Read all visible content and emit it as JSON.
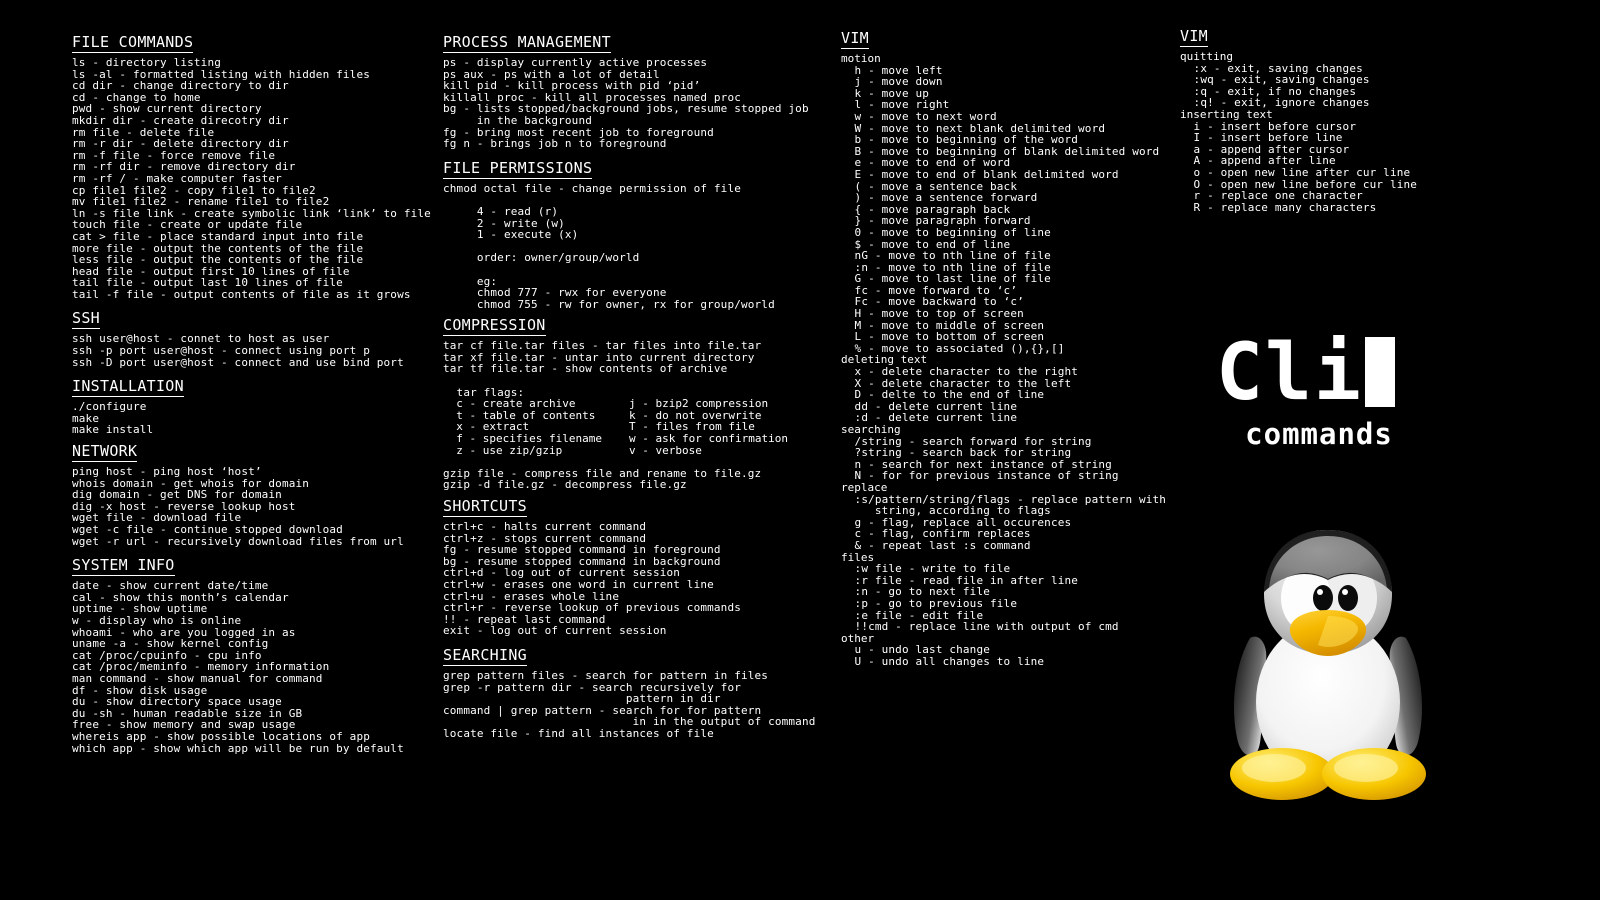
{
  "meta": {
    "background_color": "#000000",
    "text_color": "#ffffff",
    "logo_accent": "#ffffff"
  },
  "logo": {
    "title": "Cli",
    "cursor": "block-cursor",
    "subtitle": "commands"
  },
  "columns": {
    "col1": [
      {
        "heading": "FILE COMMANDS",
        "lines": [
          "ls - directory listing",
          "ls -al - formatted listing with hidden files",
          "cd dir - change directory to dir",
          "cd - change to home",
          "pwd - show current directory",
          "mkdir dir - create direcotry dir",
          "rm file - delete file",
          "rm -r dir - delete directory dir",
          "rm -f file - force remove file",
          "rm -rf dir - remove directory dir",
          "rm -rf / - make computer faster",
          "cp file1 file2 - copy file1 to file2",
          "mv file1 file2 - rename file1 to file2",
          "ln -s file link - create symbolic link ‘link’ to file",
          "touch file - create or update file",
          "cat > file - place standard input into file",
          "more file - output the contents of the file",
          "less file - output the contents of the file",
          "head file - output first 10 lines of file",
          "tail file - output last 10 lines of file",
          "tail -f file - output contents of file as it grows"
        ]
      },
      {
        "heading": "SSH",
        "lines": [
          "ssh user@host - connet to host as user",
          "ssh -p port user@host - connect using port p",
          "ssh -D port user@host - connect and use bind port"
        ]
      },
      {
        "heading": "INSTALLATION",
        "lines": [
          "./configure",
          "make",
          "make install"
        ]
      },
      {
        "heading": "NETWORK",
        "lines": [
          "ping host - ping host ‘host’",
          "whois domain - get whois for domain",
          "dig domain - get DNS for domain",
          "dig -x host - reverse lookup host",
          "wget file - download file",
          "wget -c file - continue stopped download",
          "wget -r url - recursively download files from url"
        ]
      },
      {
        "heading": "SYSTEM INFO",
        "lines": [
          "date - show current date/time",
          "cal - show this month’s calendar",
          "uptime - show uptime",
          "w - display who is online",
          "whoami - who are you logged in as",
          "uname -a - show kernel config",
          "cat /proc/cpuinfo - cpu info",
          "cat /proc/meminfo - memory information",
          "man command - show manual for command",
          "df - show disk usage",
          "du - show directory space usage",
          "du -sh - human readable size in GB",
          "free - show memory and swap usage",
          "whereis app - show possible locations of app",
          "which app - show which app will be run by default"
        ]
      }
    ],
    "col2": [
      {
        "heading": "PROCESS MANAGEMENT",
        "lines": [
          "ps - display currently active processes",
          "ps aux - ps with a lot of detail",
          "kill pid - kill process with pid ‘pid’",
          "killall proc - kill all processes named proc",
          "bg - lists stopped/background jobs, resume stopped job",
          "     in the background",
          "fg - bring most recent job to foreground",
          "fg n - brings job n to foreground"
        ]
      },
      {
        "heading": "FILE PERMISSIONS",
        "lines": [
          "chmod octal file - change permission of file",
          "",
          "     4 - read (r)",
          "     2 - write (w)",
          "     1 - execute (x)",
          "",
          "     order: owner/group/world",
          "",
          "     eg:",
          "     chmod 777 - rwx for everyone",
          "     chmod 755 - rw for owner, rx for group/world"
        ]
      },
      {
        "heading": "COMPRESSION",
        "lines": [
          "tar cf file.tar files - tar files into file.tar",
          "tar xf file.tar - untar into current directory",
          "tar tf file.tar - show contents of archive",
          "",
          "  tar flags:"
        ],
        "flag_table": {
          "rows": [
            {
              "left": "  c - create archive",
              "right": "j - bzip2 compression"
            },
            {
              "left": "  t - table of contents",
              "right": "k - do not overwrite"
            },
            {
              "left": "  x - extract",
              "right": "T - files from file"
            },
            {
              "left": "  f - specifies filename",
              "right": "w - ask for confirmation"
            },
            {
              "left": "  z - use zip/gzip",
              "right": "v - verbose"
            }
          ]
        },
        "lines_after": [
          "",
          "gzip file - compress file and rename to file.gz",
          "gzip -d file.gz - decompress file.gz"
        ]
      },
      {
        "heading": "SHORTCUTS",
        "lines": [
          "ctrl+c - halts current command",
          "ctrl+z - stops current command",
          "fg - resume stopped command in foreground",
          "bg - resume stopped command in background",
          "ctrl+d - log out of current session",
          "ctrl+w - erases one word in current line",
          "ctrl+u - erases whole line",
          "ctrl+r - reverse lookup of previous commands",
          "!! - repeat last command",
          "exit - log out of current session"
        ]
      },
      {
        "heading": "SEARCHING",
        "lines": [
          "grep pattern files - search for pattern in files",
          "grep -r pattern dir - search recursively for",
          "                           pattern in dir",
          "command | grep pattern - search for for pattern",
          "                            in in the output of command",
          "locate file - find all instances of file"
        ]
      }
    ],
    "col3": [
      {
        "heading": "VIM",
        "groups": [
          {
            "label": "motion",
            "lines": [
              "  h - move left",
              "  j - move down",
              "  k - move up",
              "  l - move right",
              "  w - move to next word",
              "  W - move to next blank delimited word",
              "  b - move to beginning of the word",
              "  B - move to beginning of blank delimited word",
              "  e - move to end of word",
              "  E - move to end of blank delimited word",
              "  ( - move a sentence back",
              "  ) - move a sentence forward",
              "  { - move paragraph back",
              "  } - move paragraph forward",
              "  0 - move to beginning of line",
              "  $ - move to end of line",
              "  nG - move to nth line of file",
              "  :n - move to nth line of file",
              "  G - move to last line of file",
              "  fc - move forward to ‘c’",
              "  Fc - move backward to ‘c’",
              "  H - move to top of screen",
              "  M - move to middle of screen",
              "  L - move to bottom of screen",
              "  % - move to associated (),{},[]"
            ]
          },
          {
            "label": "deleting text",
            "lines": [
              "  x - delete character to the right",
              "  X - delete character to the left",
              "  D - delte to the end of line",
              "  dd - delete current line",
              "  :d - delete current line"
            ]
          },
          {
            "label": "searching",
            "lines": [
              "  /string - search forward for string",
              "  ?string - search back for string",
              "  n - search for next instance of string",
              "  N - for for previous instance of string"
            ]
          },
          {
            "label": "replace",
            "lines": [
              "  :s/pattern/string/flags - replace pattern with",
              "     string, according to flags",
              "  g - flag, replace all occurences",
              "  c - flag, confirm replaces",
              "  & - repeat last :s command"
            ]
          },
          {
            "label": "files",
            "lines": [
              "  :w file - write to file",
              "  :r file - read file in after line",
              "  :n - go to next file",
              "  :p - go to previous file",
              "  :e file - edit file",
              "  !!cmd - replace line with output of cmd"
            ]
          },
          {
            "label": "other",
            "lines": [
              "  u - undo last change",
              "  U - undo all changes to line"
            ]
          }
        ]
      }
    ],
    "col4": [
      {
        "heading": "VIM",
        "groups": [
          {
            "label": "quitting",
            "lines": [
              "  :x - exit, saving changes",
              "  :wq - exit, saving changes",
              "  :q - exit, if no changes",
              "  :q! - exit, ignore changes"
            ]
          },
          {
            "label": "inserting text",
            "lines": [
              "  i - insert before cursor",
              "  I - insert before line",
              "  a - append after cursor",
              "  A - append after line",
              "  o - open new line after cur line",
              "  O - open new line before cur line",
              "  r - replace one character",
              "  R - replace many characters"
            ]
          }
        ]
      }
    ]
  }
}
